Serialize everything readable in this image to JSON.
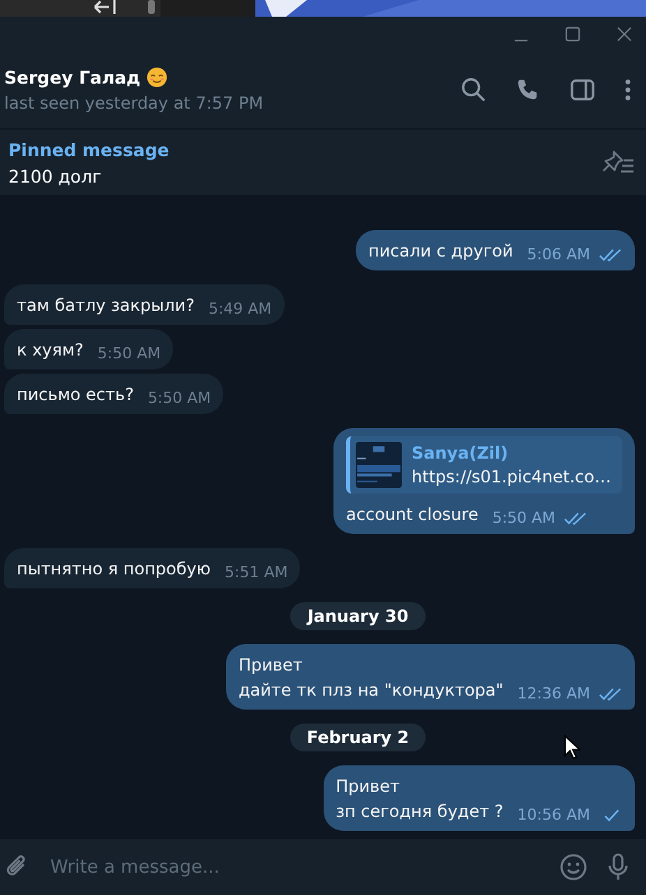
{
  "chat": {
    "name": "Sergey Галад",
    "status": "last seen yesterday at 7:57 PM"
  },
  "pinned": {
    "label": "Pinned message",
    "text": "2100 долг"
  },
  "messages": [
    {
      "kind": "outgoing",
      "text": "писали с другой",
      "time": "5:06 AM",
      "read": true
    },
    {
      "kind": "incoming",
      "text": "там батлу закрыли?",
      "time": "5:49 AM"
    },
    {
      "kind": "incoming",
      "text": "к хуям?",
      "time": "5:50 AM"
    },
    {
      "kind": "incoming",
      "text": "письмо есть?",
      "time": "5:50 AM"
    },
    {
      "kind": "outgoing",
      "reply": {
        "author": "Sanya(Zil)",
        "text": "https://s01.pic4net.co…"
      },
      "text": "account closure",
      "time": "5:50 AM",
      "read": true
    },
    {
      "kind": "incoming",
      "text": "пытнятно я попробую",
      "time": "5:51 AM"
    },
    {
      "kind": "date",
      "text": "January 30"
    },
    {
      "kind": "outgoing",
      "text": "Привет\nдайте тк плз на \"кондуктора\"",
      "time": "12:36 AM",
      "read": true
    },
    {
      "kind": "date",
      "text": "February 2"
    },
    {
      "kind": "outgoing",
      "text": "Привет\nзп сегодня будет ?",
      "time": "10:56 AM",
      "read": false
    }
  ],
  "composer": {
    "placeholder": "Write a message..."
  }
}
